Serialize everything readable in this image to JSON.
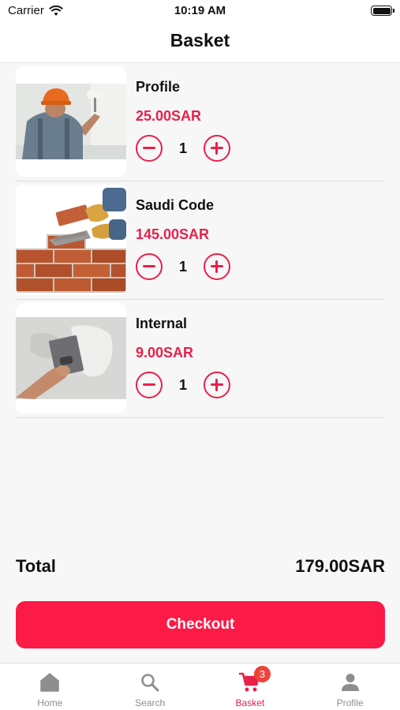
{
  "status_bar": {
    "carrier": "Carrier",
    "time": "10:19 AM"
  },
  "nav": {
    "title": "Basket"
  },
  "items": [
    {
      "name": "Profile",
      "price": "25.00SAR",
      "quantity": "1",
      "image_icon": "painter-roller-photo"
    },
    {
      "name": "Saudi Code",
      "price": "145.00SAR",
      "quantity": "1",
      "image_icon": "bricklaying-photo"
    },
    {
      "name": "Internal",
      "price": "9.00SAR",
      "quantity": "1",
      "image_icon": "plastering-photo"
    }
  ],
  "summary": {
    "total_label": "Total",
    "total_value": "179.00SAR"
  },
  "checkout_label": "Checkout",
  "tabs": [
    {
      "label": "Home",
      "icon": "home-icon"
    },
    {
      "label": "Search",
      "icon": "search-icon"
    },
    {
      "label": "Basket",
      "icon": "cart-icon",
      "badge": "3",
      "active": true
    },
    {
      "label": "Profile",
      "icon": "person-icon"
    }
  ],
  "colors": {
    "accent": "#e8204a",
    "button": "#fc1a47",
    "badge": "#f0423a",
    "inactive": "#8e8e8e"
  }
}
